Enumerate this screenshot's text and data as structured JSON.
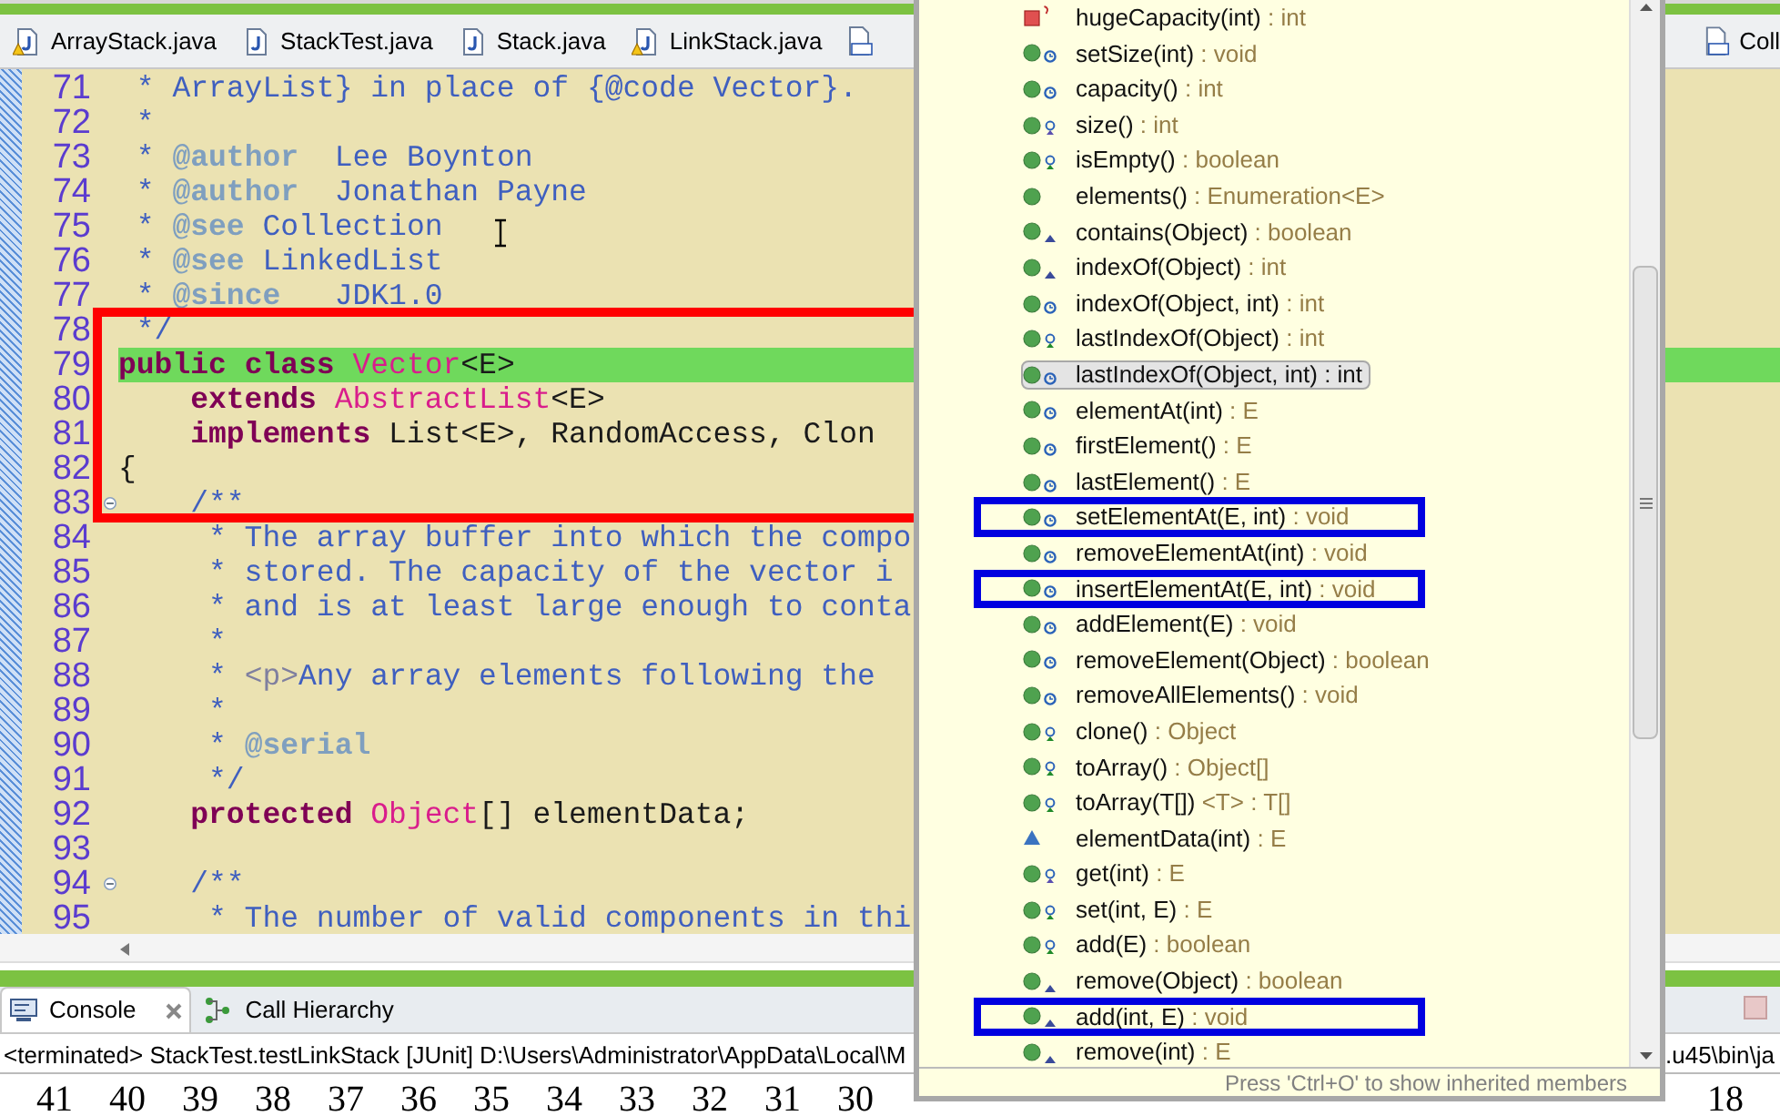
{
  "editor_tabs": [
    {
      "label": "ArrayStack.java",
      "warning": true
    },
    {
      "label": "StackTest.java",
      "warning": false
    },
    {
      "label": "Stack.java",
      "warning": false
    },
    {
      "label": "LinkStack.java",
      "warning": true
    }
  ],
  "right_tab": {
    "label": "Coll"
  },
  "editor": {
    "blocks": [
      {
        "framed": false,
        "lines": [
          {
            "number": "71",
            "tokens": [
              {
                "kind": "comment",
                "text": " * ArrayList} in place of {@code Vector}."
              }
            ]
          },
          {
            "number": "72",
            "tokens": [
              {
                "kind": "comment",
                "text": " *"
              }
            ]
          },
          {
            "number": "73",
            "tokens": [
              {
                "kind": "comment",
                "text": " * "
              },
              {
                "kind": "doctag",
                "text": "@author"
              },
              {
                "kind": "comment",
                "text": "  Lee Boynton"
              }
            ]
          },
          {
            "number": "74",
            "tokens": [
              {
                "kind": "comment",
                "text": " * "
              },
              {
                "kind": "doctag",
                "text": "@author"
              },
              {
                "kind": "comment",
                "text": "  Jonathan Payne"
              }
            ]
          },
          {
            "number": "75",
            "tokens": [
              {
                "kind": "comment",
                "text": " * "
              },
              {
                "kind": "doctag",
                "text": "@see"
              },
              {
                "kind": "comment",
                "text": " Collection"
              }
            ]
          },
          {
            "number": "76",
            "tokens": [
              {
                "kind": "comment",
                "text": " * "
              },
              {
                "kind": "doctag",
                "text": "@see"
              },
              {
                "kind": "comment",
                "text": " LinkedList"
              }
            ]
          },
          {
            "number": "77",
            "tokens": [
              {
                "kind": "comment",
                "text": " * "
              },
              {
                "kind": "doctag",
                "text": "@since"
              },
              {
                "kind": "comment",
                "text": "   JDK1.0"
              }
            ]
          }
        ]
      },
      {
        "framed": true,
        "lines": [
          {
            "number": "78",
            "tokens": [
              {
                "kind": "comment",
                "text": " */"
              }
            ]
          },
          {
            "number": "79",
            "current": true,
            "tokens": [
              {
                "kind": "keyword",
                "text": "public"
              },
              {
                "kind": "keyword",
                "text": " class"
              },
              {
                "kind": "type",
                "text": " Vector"
              },
              {
                "kind": "plain",
                "text": "<E>"
              }
            ]
          },
          {
            "number": "80",
            "tokens": [
              {
                "kind": "keyword",
                "text": "    extends"
              },
              {
                "kind": "type",
                "text": " AbstractList"
              },
              {
                "kind": "plain",
                "text": "<E>"
              }
            ]
          },
          {
            "number": "81",
            "tokens": [
              {
                "kind": "keyword",
                "text": "    implements"
              },
              {
                "kind": "plain",
                "text": " List<E>, RandomAccess, Clon"
              }
            ]
          },
          {
            "number": "82",
            "tokens": [
              {
                "kind": "plain",
                "text": "{"
              }
            ]
          },
          {
            "number": "83",
            "foldable": true,
            "tokens": [
              {
                "kind": "comment",
                "text": "    /**"
              }
            ]
          }
        ]
      },
      {
        "framed": false,
        "lines": [
          {
            "number": "84",
            "tokens": [
              {
                "kind": "comment",
                "text": "     * The array buffer into which the compo"
              }
            ]
          },
          {
            "number": "85",
            "tokens": [
              {
                "kind": "comment",
                "text": "     * stored. The capacity of the vector i"
              }
            ]
          },
          {
            "number": "86",
            "tokens": [
              {
                "kind": "comment",
                "text": "     * and is at least large enough to conta"
              }
            ]
          },
          {
            "number": "87",
            "tokens": [
              {
                "kind": "comment",
                "text": "     *"
              }
            ]
          },
          {
            "number": "88",
            "tokens": [
              {
                "kind": "comment",
                "text": "     * "
              },
              {
                "kind": "html",
                "text": "<p>"
              },
              {
                "kind": "comment",
                "text": "Any array elements following the"
              }
            ]
          },
          {
            "number": "89",
            "tokens": [
              {
                "kind": "comment",
                "text": "     *"
              }
            ]
          },
          {
            "number": "90",
            "tokens": [
              {
                "kind": "comment",
                "text": "     * "
              },
              {
                "kind": "doctag",
                "text": "@serial"
              }
            ]
          },
          {
            "number": "91",
            "tokens": [
              {
                "kind": "comment",
                "text": "     */"
              }
            ]
          },
          {
            "number": "92",
            "tokens": [
              {
                "kind": "keyword",
                "text": "    protected"
              },
              {
                "kind": "type",
                "text": " Object"
              },
              {
                "kind": "plain",
                "text": "[] elementData;"
              }
            ]
          },
          {
            "number": "93"
          },
          {
            "number": "94",
            "foldable": true,
            "tokens": [
              {
                "kind": "comment",
                "text": "    /**"
              }
            ]
          },
          {
            "number": "95",
            "tokens": [
              {
                "kind": "comment",
                "text": "     * The number of valid components in thi"
              }
            ]
          }
        ]
      }
    ]
  },
  "console": {
    "tabs": [
      {
        "label": "Console",
        "selected": true
      },
      {
        "label": "Call Hierarchy",
        "selected": false
      }
    ],
    "status": "<terminated> StackTest.testLinkStack [JUnit] D:\\Users\\Administrator\\AppData\\Local\\M",
    "status_tail": ".u45\\bin\\ja",
    "output": "41    40    39    38    37    36    35    34    33    32    31    30",
    "output_tail": "18"
  },
  "outline_popup": {
    "items": [
      {
        "signature": "hugeCapacity(int)",
        "suffix": ": int",
        "kind": "private-static",
        "selected": false,
        "framed": false
      },
      {
        "signature": "setSize(int)",
        "suffix": ": void",
        "kind": "public-synchronized",
        "selected": false,
        "framed": false
      },
      {
        "signature": "capacity()",
        "suffix": ": int",
        "kind": "public-synchronized",
        "selected": false,
        "framed": false
      },
      {
        "signature": "size()",
        "suffix": ": int",
        "kind": "public-implements",
        "selected": false,
        "framed": false
      },
      {
        "signature": "isEmpty()",
        "suffix": ": boolean",
        "kind": "public-overrides",
        "selected": false,
        "framed": false
      },
      {
        "signature": "elements()",
        "suffix": ": Enumeration<E>",
        "kind": "public",
        "selected": false,
        "framed": false
      },
      {
        "signature": "contains(Object)",
        "suffix": ": boolean",
        "kind": "public-inherited",
        "selected": false,
        "framed": false
      },
      {
        "signature": "indexOf(Object)",
        "suffix": ": int",
        "kind": "public-inherited",
        "selected": false,
        "framed": false
      },
      {
        "signature": "indexOf(Object, int)",
        "suffix": ": int",
        "kind": "public-synchronized",
        "selected": false,
        "framed": false
      },
      {
        "signature": "lastIndexOf(Object)",
        "suffix": ": int",
        "kind": "public-overrides",
        "selected": false,
        "framed": false
      },
      {
        "signature": "lastIndexOf(Object, int)",
        "suffix": ": int",
        "kind": "public-synchronized",
        "selected": true,
        "framed": false
      },
      {
        "signature": "elementAt(int)",
        "suffix": ": E",
        "kind": "public-synchronized",
        "selected": false,
        "framed": false
      },
      {
        "signature": "firstElement()",
        "suffix": ": E",
        "kind": "public-synchronized",
        "selected": false,
        "framed": false
      },
      {
        "signature": "lastElement()",
        "suffix": ": E",
        "kind": "public-synchronized",
        "selected": false,
        "framed": false
      },
      {
        "signature": "setElementAt(E, int)",
        "suffix": ": void",
        "kind": "public-synchronized",
        "selected": false,
        "framed": true
      },
      {
        "signature": "removeElementAt(int)",
        "suffix": ": void",
        "kind": "public-synchronized",
        "selected": false,
        "framed": false
      },
      {
        "signature": "insertElementAt(E, int)",
        "suffix": ": void",
        "kind": "public-synchronized",
        "selected": false,
        "framed": true
      },
      {
        "signature": "addElement(E)",
        "suffix": ": void",
        "kind": "public-synchronized",
        "selected": false,
        "framed": false
      },
      {
        "signature": "removeElement(Object)",
        "suffix": ": boolean",
        "kind": "public-synchronized",
        "selected": false,
        "framed": false
      },
      {
        "signature": "removeAllElements()",
        "suffix": ": void",
        "kind": "public-synchronized",
        "selected": false,
        "framed": false
      },
      {
        "signature": "clone()",
        "suffix": ": Object",
        "kind": "public-overrides",
        "selected": false,
        "framed": false
      },
      {
        "signature": "toArray()",
        "suffix": ": Object[]",
        "kind": "public-overrides",
        "selected": false,
        "framed": false
      },
      {
        "signature": "toArray(T[])",
        "suffix": "<T> : T[]",
        "kind": "public-overrides",
        "selected": false,
        "framed": false
      },
      {
        "signature": "elementData(int)",
        "suffix": ": E",
        "kind": "package",
        "selected": false,
        "framed": false
      },
      {
        "signature": "get(int)",
        "suffix": ": E",
        "kind": "public-implements",
        "selected": false,
        "framed": false
      },
      {
        "signature": "set(int, E)",
        "suffix": ": E",
        "kind": "public-overrides",
        "selected": false,
        "framed": false
      },
      {
        "signature": "add(E)",
        "suffix": ": boolean",
        "kind": "public-overrides",
        "selected": false,
        "framed": false
      },
      {
        "signature": "remove(Object)",
        "suffix": ": boolean",
        "kind": "public-inherited",
        "selected": false,
        "framed": false
      },
      {
        "signature": "add(int, E)",
        "suffix": ": void",
        "kind": "public-inherited",
        "selected": false,
        "framed": true
      },
      {
        "signature": "remove(int)",
        "suffix": ": E",
        "kind": "public-inherited",
        "selected": false,
        "framed": false
      }
    ],
    "footer": "Press 'Ctrl+O' to show inherited members"
  }
}
